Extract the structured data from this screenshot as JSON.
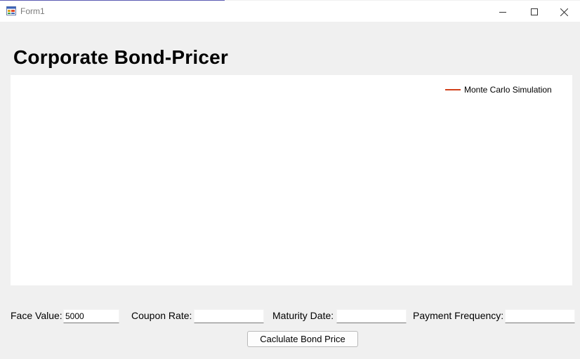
{
  "window": {
    "title": "Form1",
    "icon": "windows-form-icon",
    "controls": [
      "minimize-icon",
      "maximize-icon",
      "close-icon"
    ]
  },
  "heading": "Corporate Bond-Pricer",
  "chart": {
    "legend": {
      "label": "Monte Carlo Simulation",
      "color": "#d2411b"
    }
  },
  "form": {
    "face_value_label": "Face Value:",
    "face_value": "5000",
    "coupon_rate_label": "Coupon Rate:",
    "coupon_rate": "",
    "maturity_date_label": "Maturity Date:",
    "maturity_date": "",
    "payment_frequency_label": "Payment Frequency:",
    "payment_frequency": ""
  },
  "button": {
    "calculate_label": "Caclulate Bond Price"
  },
  "colors": {
    "background": "#f0f0f0",
    "titlebar": "#ffffff",
    "series": "#d2411b"
  }
}
